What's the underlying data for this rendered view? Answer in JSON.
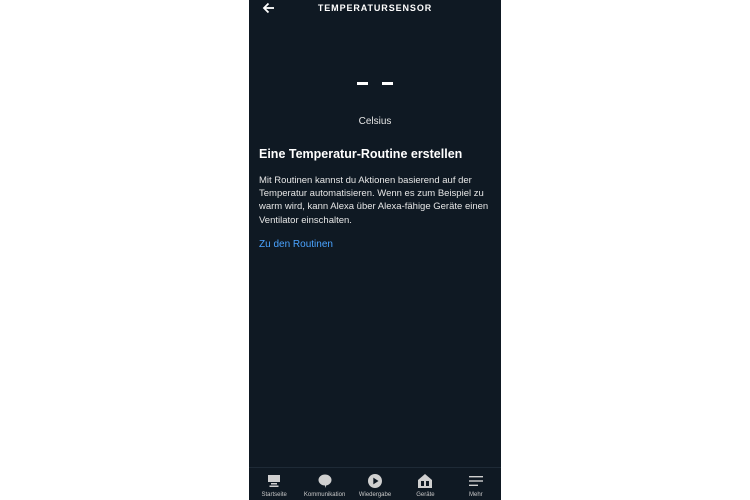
{
  "header": {
    "title": "TEMPERATURSENSOR",
    "back_icon": "arrow-left-icon"
  },
  "temperature": {
    "value": "- -",
    "unit": "Celsius"
  },
  "routine": {
    "heading": "Eine Temperatur-Routine erstellen",
    "description": "Mit Routinen kannst du Aktionen basierend auf der Temperatur automatisieren. Wenn es zum Beispiel zu warm wird, kann Alexa über Alexa-fähige Geräte einen Ventilator einschalten.",
    "link_label": "Zu den Routinen",
    "link_color": "#4aa3ff"
  },
  "colors": {
    "background": "#0f1923",
    "text": "#ffffff"
  },
  "bottom_nav": {
    "items": [
      {
        "label": "Startseite",
        "icon": "home-icon"
      },
      {
        "label": "Kommunikation",
        "icon": "speech-bubble-icon"
      },
      {
        "label": "Wiedergabe",
        "icon": "play-icon"
      },
      {
        "label": "Geräte",
        "icon": "devices-icon"
      },
      {
        "label": "Mehr",
        "icon": "menu-icon"
      }
    ]
  }
}
